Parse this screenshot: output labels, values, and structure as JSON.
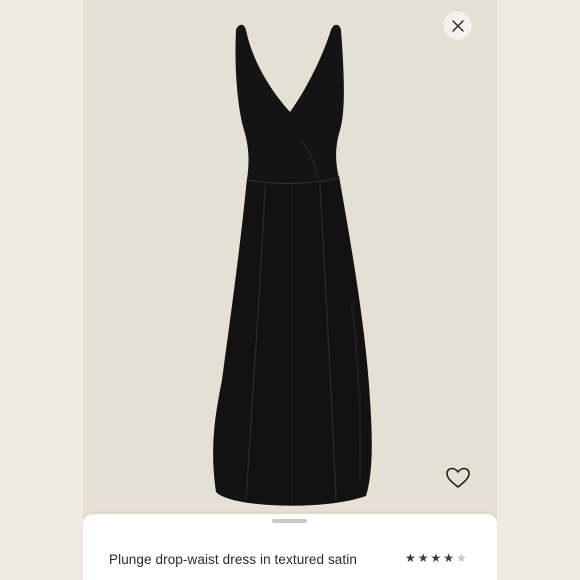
{
  "product": {
    "title": "Plunge drop-waist dress in textured satin",
    "rating": 4,
    "rating_max": 5
  },
  "icons": {
    "close": "close-icon",
    "favorite": "heart-icon",
    "star": "star-icon"
  },
  "colors": {
    "background": "#f0ebe2",
    "photo_background": "#e6dfd3",
    "dress": "#121212",
    "star_filled": "#3a3a3a",
    "star_empty": "#c4c4c4"
  },
  "stars": [
    "★",
    "★",
    "★",
    "★",
    "★"
  ]
}
